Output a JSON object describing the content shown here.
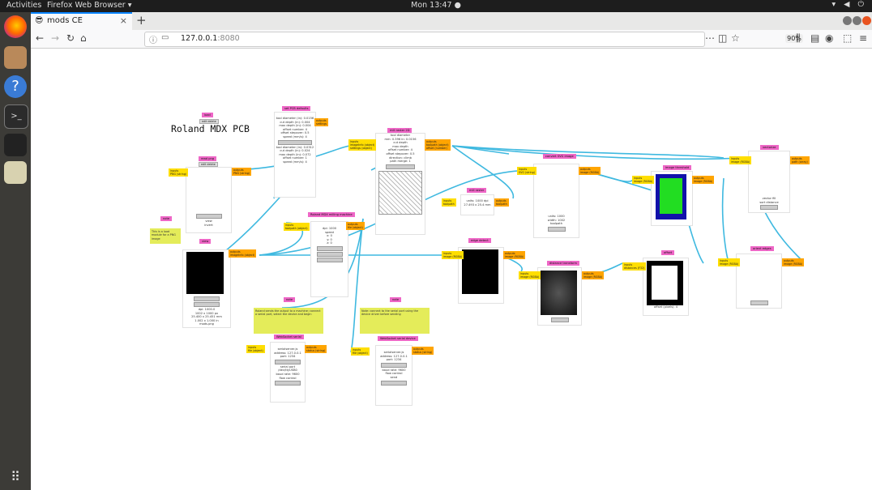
{
  "topbar": {
    "activities": "Activities",
    "app_menu": "Firefox Web Browser ▾",
    "clock": "Mon 13:47 ●"
  },
  "browser": {
    "tab_title": "mods CE",
    "url_host": "127.0.0.1",
    "url_port": ":8080",
    "zoom": "90%"
  },
  "canvas": {
    "title": "Roland MDX PCB"
  },
  "modules": {
    "set_pcb": {
      "title": "set PCB defaults",
      "outputs": "outputs\nsettings"
    },
    "read_png": {
      "title": "read png",
      "edit": "edit delete",
      "outputs": "outputs\nPNG (string)",
      "stats": "dpi: 1000.0\n1002 x 1000 px\n25.400 x 25.451 mm\n1.002 x 1.000 in\nmods.png",
      "buttons": [
        "select png file",
        "view",
        "invert"
      ]
    },
    "mill_raster": {
      "title": "mill raster 2D",
      "edit": "edit delete",
      "inputs": "inputs\nimageInfo (object)\nimage (RGBA)\nsettings (object)",
      "outputs": "outputs\ntoolpath (object)\noffset (number)\ndistance (object)"
    },
    "vector": {
      "title": "vectorize",
      "edit": "edit delete"
    },
    "note1": "Roland sends the output to a machine; connect a serial port, select the device and begin",
    "note2": "Note: connect to the serial port using the device driver before sending"
  }
}
